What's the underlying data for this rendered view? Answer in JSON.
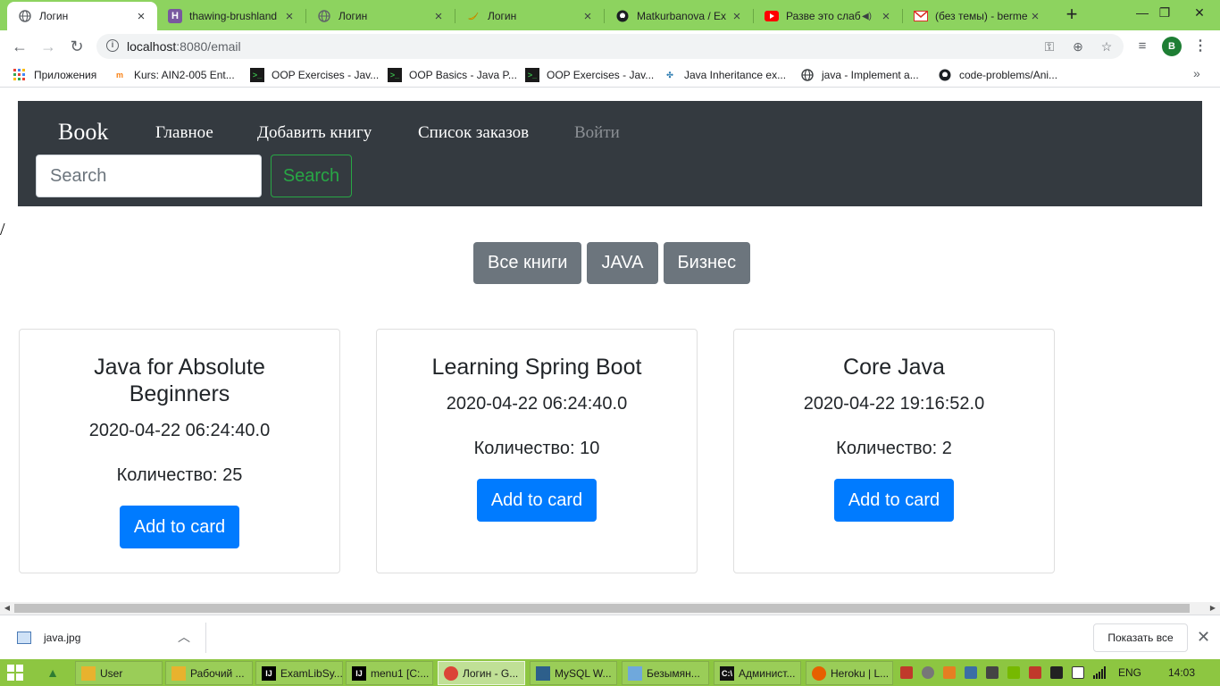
{
  "browser": {
    "tabs": [
      {
        "title": "Логин",
        "icon": "globe-icon",
        "active": true
      },
      {
        "title": "thawing-brushland",
        "icon": "heroku-icon",
        "active": false
      },
      {
        "title": "Логин",
        "icon": "globe-icon",
        "active": false
      },
      {
        "title": "Логин",
        "icon": "banana-icon",
        "active": false
      },
      {
        "title": "Matkurbanova / Ex",
        "icon": "github-icon",
        "active": false
      },
      {
        "title": "Разве это слаб",
        "icon": "youtube-icon",
        "active": false
      },
      {
        "title": "(без темы) - berme",
        "icon": "gmail-icon",
        "active": false
      }
    ],
    "address": {
      "host": "localhost",
      "port_path": ":8080/email"
    },
    "profile_initial": "B",
    "bookmarks": [
      {
        "label": "Приложения",
        "icon": "apps-grid-icon"
      },
      {
        "label": "Kurs: AIN2-005 Ent...",
        "icon": "moodle-icon"
      },
      {
        "label": "OOP Exercises - Jav...",
        "icon": "hackerrank-icon"
      },
      {
        "label": "OOP Basics - Java P...",
        "icon": "hackerrank-icon"
      },
      {
        "label": "OOP Exercises - Jav...",
        "icon": "hackerrank-icon"
      },
      {
        "label": "Java Inheritance ex...",
        "icon": "w3resource-icon"
      },
      {
        "label": "java - Implement a...",
        "icon": "stackoverflow-icon"
      },
      {
        "label": "code-problems/Ani...",
        "icon": "github-icon"
      }
    ]
  },
  "site": {
    "brand": "Book",
    "nav": [
      "Главное",
      "Добавить книгу",
      "Список заказов",
      "Войти"
    ],
    "search_placeholder": "Search",
    "search_button": "Search",
    "stray_text": "/",
    "categories": [
      "Все книги",
      "JAVA",
      "Бизнес"
    ],
    "books": [
      {
        "title": "Java for Absolute Beginners",
        "date": "2020-04-22 06:24:40.0",
        "quantity_label": "Количество: 25",
        "button": "Add to card"
      },
      {
        "title": "Learning Spring Boot",
        "date": "2020-04-22 06:24:40.0",
        "quantity_label": "Количество: 10",
        "button": "Add to card"
      },
      {
        "title": "Core Java",
        "date": "2020-04-22 19:16:52.0",
        "quantity_label": "Количество: 2",
        "button": "Add to card"
      }
    ]
  },
  "downloads": {
    "file": "java.jpg",
    "show_all": "Показать все"
  },
  "taskbar": {
    "items": [
      "User",
      "Рабочий ...",
      "ExamLibSy...",
      "menu1 [C:...",
      "Логин - G...",
      "MySQL W...",
      "Безымян...",
      "Админист...",
      "Heroku | L..."
    ],
    "language": "ENG",
    "time": "14:03"
  },
  "colors": {
    "tab_strip": "#8dd35f",
    "navbar": "#343a40",
    "primary_button": "#007bff",
    "secondary_button": "#6c757d",
    "success_outline": "#28a745",
    "taskbar": "#8dc641"
  }
}
